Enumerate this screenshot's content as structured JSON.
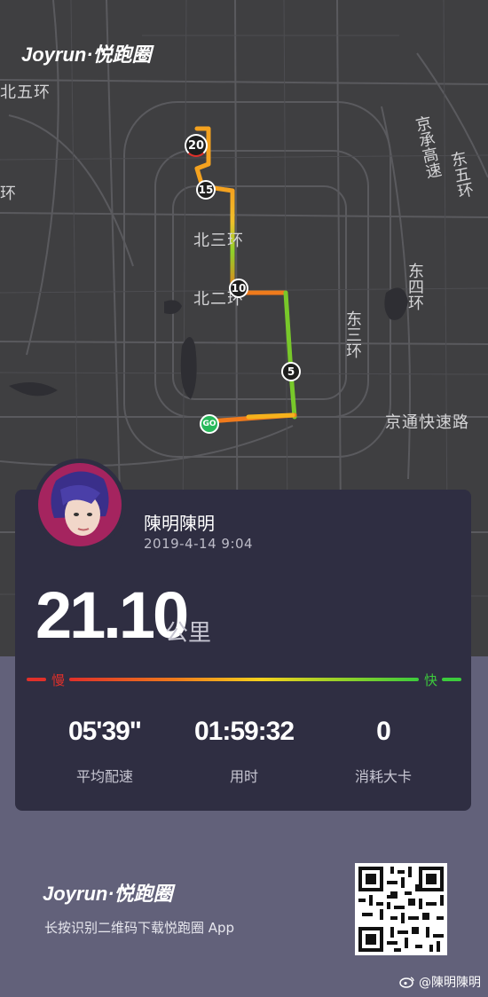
{
  "app": {
    "brand": "Joyrun·悦跑圈"
  },
  "map": {
    "labels": {
      "north_fifth_ring": "北五环",
      "jingcheng_expressway": "京承高速",
      "east_fifth_ring": "东五环",
      "north_third_ring": "北三环",
      "north_second_ring": "北二环",
      "east_fourth_ring": "东四环",
      "east_third_ring": "东三环",
      "jingtong_expressway": "京通快速路",
      "fragment_left": "环"
    },
    "markers": {
      "km20": "20",
      "km15": "15",
      "km10": "10",
      "km5": "5",
      "start": "GO"
    }
  },
  "user": {
    "name": "陳明陳明",
    "datetime": "2019-4-14 9:04"
  },
  "run": {
    "distance": "21.10",
    "distance_unit": "公里",
    "pace_scale": {
      "slow": "慢",
      "fast": "快"
    },
    "stats": [
      {
        "value": "05'39\"",
        "label": "平均配速"
      },
      {
        "value": "01:59:32",
        "label": "用时"
      },
      {
        "value": "0",
        "label": "消耗大卡"
      }
    ]
  },
  "footer": {
    "brand": "Joyrun·悦跑圈",
    "tagline": "长按识别二维码下载悦跑圈 App",
    "watermark": "@陳明陳明"
  },
  "colors": {
    "accent_slow": "#e0302a",
    "accent_fast": "#3ccb3c",
    "card_bg": "#2f2e42",
    "avatar_ring": "#a5245f"
  }
}
